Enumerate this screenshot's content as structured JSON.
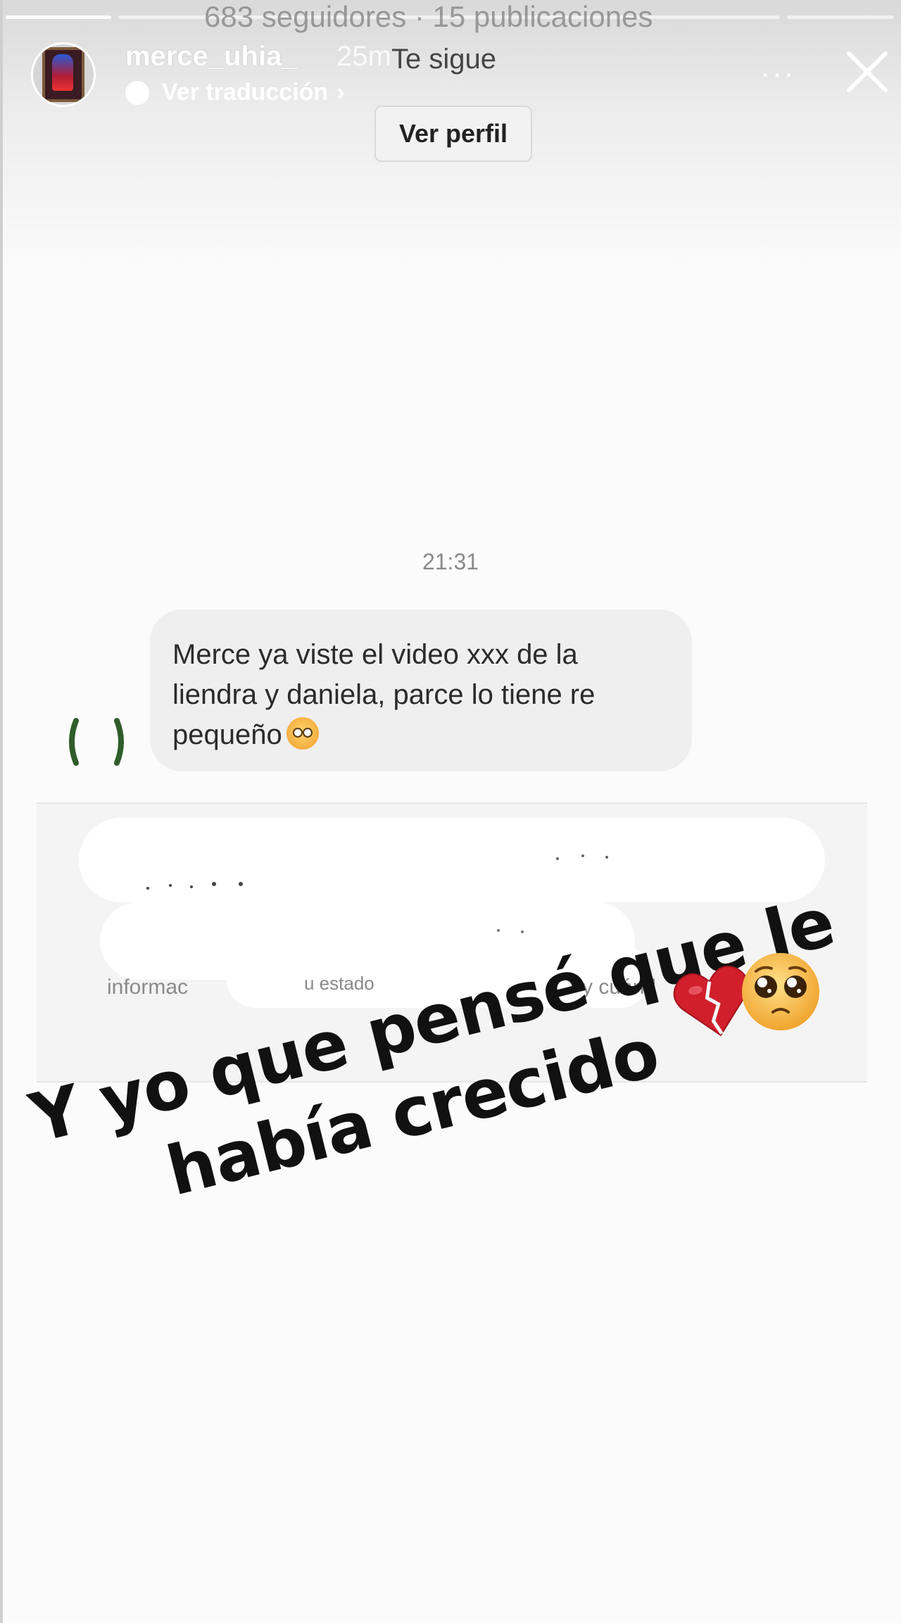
{
  "story_header": {
    "profile_stats": "683 seguidores · 15 publicaciones",
    "username": "merce_uhia_",
    "time_ago": "25m",
    "follow_status": "Te sigue",
    "translate_label": "Ver traducción",
    "translate_chevron": "›",
    "more_label": "···",
    "view_profile_label": "Ver perfil",
    "progress_segments": 3
  },
  "chat": {
    "timestamp": "21:31",
    "message_line1": "Merce ya viste el video xxx de la",
    "message_line2": "liendra y daniela, parce lo tiene re",
    "message_line3": "pequeño",
    "message_emoji": "flushed-face"
  },
  "notice_fragments": {
    "left": "informac",
    "middle": "u estado",
    "right": "y cuánd"
  },
  "sticker": {
    "line1": "Y yo que pensé que le",
    "line2": "había crecido",
    "emojis": [
      "broken-heart",
      "pleading-face"
    ]
  },
  "colors": {
    "bubble_bg": "#efefef",
    "sticker_text": "#111111",
    "heart_red": "#d11f2c",
    "emoji_yellow": "#f6b73c"
  }
}
